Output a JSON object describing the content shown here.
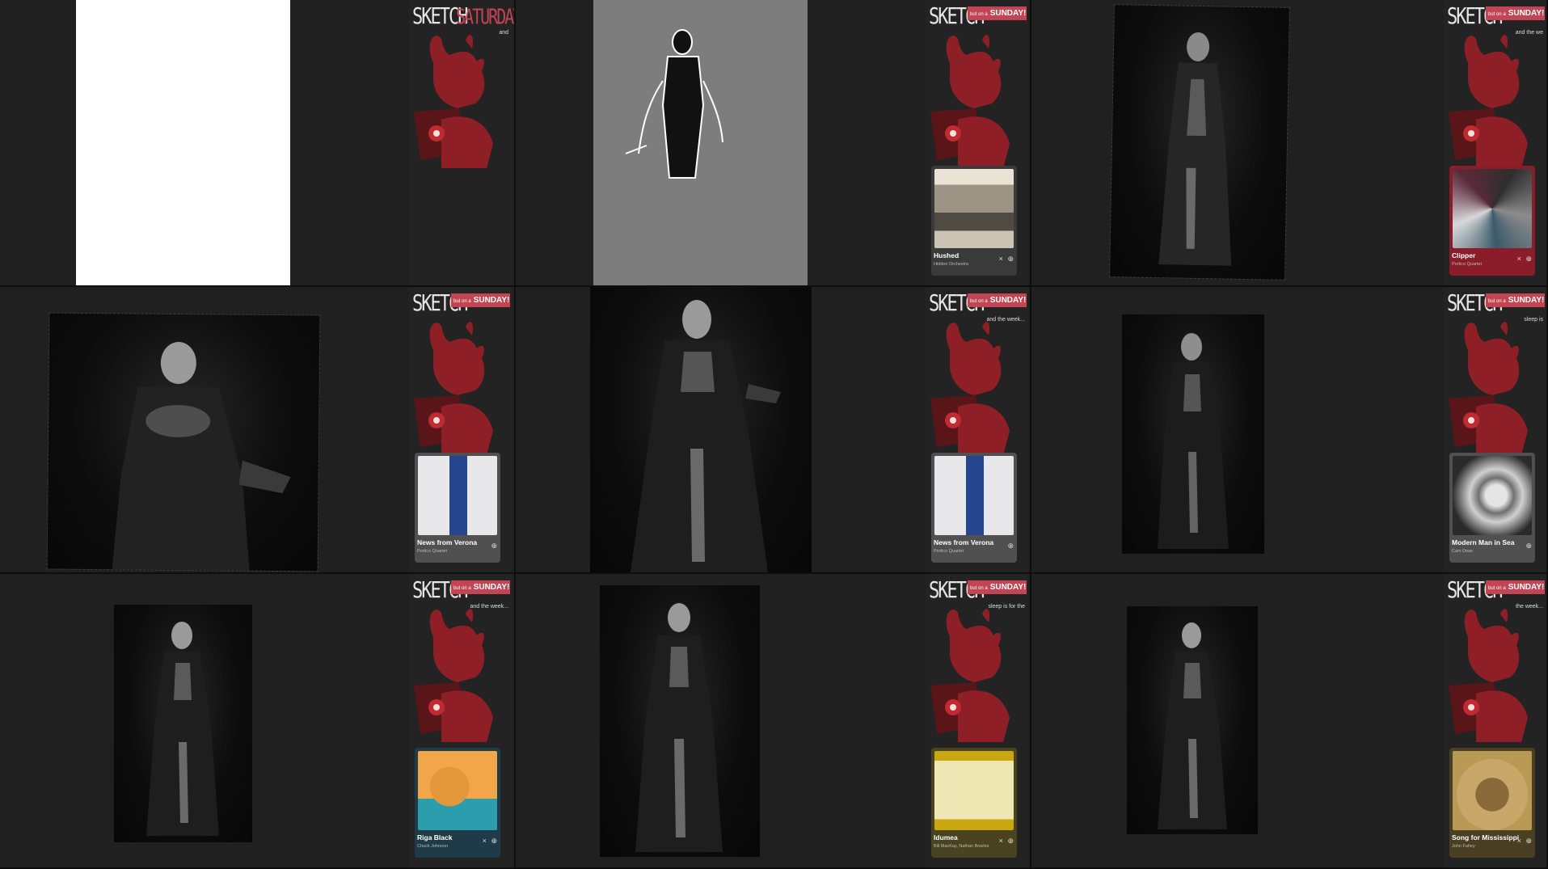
{
  "logo": {
    "sketch": "SKETCH",
    "saturday": "SATURDAY",
    "sunday": "SUNDAY!",
    "sunday_prefix": "but on a"
  },
  "controls": {
    "close": "×",
    "add": "⊕"
  },
  "cells": [
    {
      "caption": "and",
      "music": null
    },
    {
      "caption": "",
      "music": {
        "title": "Hushed",
        "artist": "Hidden Orchestra"
      }
    },
    {
      "caption": "and the we",
      "music": {
        "title": "Clipper",
        "artist": "Portico Quartet"
      }
    },
    {
      "caption": "",
      "music": {
        "title": "News from Verona",
        "artist": "Portico Quartet"
      }
    },
    {
      "caption": "and the week...",
      "music": {
        "title": "News from Verona",
        "artist": "Portico Quartet"
      }
    },
    {
      "caption": "sleep is",
      "music": {
        "title": "Modern Man in Sea",
        "artist": "Cam Deas"
      }
    },
    {
      "caption": "and the week...",
      "music": {
        "title": "Riga Black",
        "artist": "Chuck Johnson"
      }
    },
    {
      "caption": "sleep is for the",
      "music": {
        "title": "Idumea",
        "artist": "Bill MacKay, Nathan Bowles"
      }
    },
    {
      "caption": "the week...",
      "music": {
        "title": "Song for Mississippi",
        "artist": "John Fahey"
      }
    }
  ],
  "colors": {
    "accent": "#c14553",
    "mascot": "#8e1f27",
    "panel_bg": "#232323"
  }
}
